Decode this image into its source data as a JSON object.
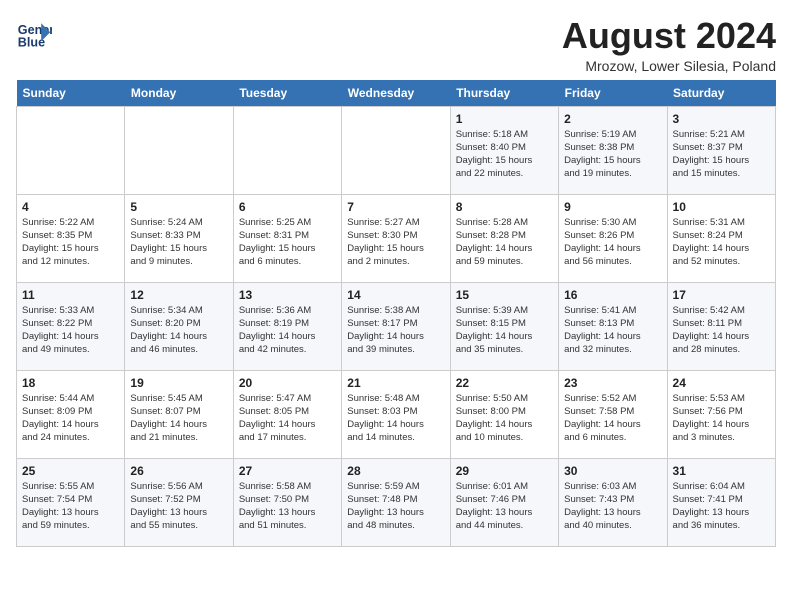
{
  "header": {
    "logo_line1": "General",
    "logo_line2": "Blue",
    "month_title": "August 2024",
    "location": "Mrozow, Lower Silesia, Poland"
  },
  "weekdays": [
    "Sunday",
    "Monday",
    "Tuesday",
    "Wednesday",
    "Thursday",
    "Friday",
    "Saturday"
  ],
  "weeks": [
    [
      {
        "day": "",
        "info": ""
      },
      {
        "day": "",
        "info": ""
      },
      {
        "day": "",
        "info": ""
      },
      {
        "day": "",
        "info": ""
      },
      {
        "day": "1",
        "info": "Sunrise: 5:18 AM\nSunset: 8:40 PM\nDaylight: 15 hours\nand 22 minutes."
      },
      {
        "day": "2",
        "info": "Sunrise: 5:19 AM\nSunset: 8:38 PM\nDaylight: 15 hours\nand 19 minutes."
      },
      {
        "day": "3",
        "info": "Sunrise: 5:21 AM\nSunset: 8:37 PM\nDaylight: 15 hours\nand 15 minutes."
      }
    ],
    [
      {
        "day": "4",
        "info": "Sunrise: 5:22 AM\nSunset: 8:35 PM\nDaylight: 15 hours\nand 12 minutes."
      },
      {
        "day": "5",
        "info": "Sunrise: 5:24 AM\nSunset: 8:33 PM\nDaylight: 15 hours\nand 9 minutes."
      },
      {
        "day": "6",
        "info": "Sunrise: 5:25 AM\nSunset: 8:31 PM\nDaylight: 15 hours\nand 6 minutes."
      },
      {
        "day": "7",
        "info": "Sunrise: 5:27 AM\nSunset: 8:30 PM\nDaylight: 15 hours\nand 2 minutes."
      },
      {
        "day": "8",
        "info": "Sunrise: 5:28 AM\nSunset: 8:28 PM\nDaylight: 14 hours\nand 59 minutes."
      },
      {
        "day": "9",
        "info": "Sunrise: 5:30 AM\nSunset: 8:26 PM\nDaylight: 14 hours\nand 56 minutes."
      },
      {
        "day": "10",
        "info": "Sunrise: 5:31 AM\nSunset: 8:24 PM\nDaylight: 14 hours\nand 52 minutes."
      }
    ],
    [
      {
        "day": "11",
        "info": "Sunrise: 5:33 AM\nSunset: 8:22 PM\nDaylight: 14 hours\nand 49 minutes."
      },
      {
        "day": "12",
        "info": "Sunrise: 5:34 AM\nSunset: 8:20 PM\nDaylight: 14 hours\nand 46 minutes."
      },
      {
        "day": "13",
        "info": "Sunrise: 5:36 AM\nSunset: 8:19 PM\nDaylight: 14 hours\nand 42 minutes."
      },
      {
        "day": "14",
        "info": "Sunrise: 5:38 AM\nSunset: 8:17 PM\nDaylight: 14 hours\nand 39 minutes."
      },
      {
        "day": "15",
        "info": "Sunrise: 5:39 AM\nSunset: 8:15 PM\nDaylight: 14 hours\nand 35 minutes."
      },
      {
        "day": "16",
        "info": "Sunrise: 5:41 AM\nSunset: 8:13 PM\nDaylight: 14 hours\nand 32 minutes."
      },
      {
        "day": "17",
        "info": "Sunrise: 5:42 AM\nSunset: 8:11 PM\nDaylight: 14 hours\nand 28 minutes."
      }
    ],
    [
      {
        "day": "18",
        "info": "Sunrise: 5:44 AM\nSunset: 8:09 PM\nDaylight: 14 hours\nand 24 minutes."
      },
      {
        "day": "19",
        "info": "Sunrise: 5:45 AM\nSunset: 8:07 PM\nDaylight: 14 hours\nand 21 minutes."
      },
      {
        "day": "20",
        "info": "Sunrise: 5:47 AM\nSunset: 8:05 PM\nDaylight: 14 hours\nand 17 minutes."
      },
      {
        "day": "21",
        "info": "Sunrise: 5:48 AM\nSunset: 8:03 PM\nDaylight: 14 hours\nand 14 minutes."
      },
      {
        "day": "22",
        "info": "Sunrise: 5:50 AM\nSunset: 8:00 PM\nDaylight: 14 hours\nand 10 minutes."
      },
      {
        "day": "23",
        "info": "Sunrise: 5:52 AM\nSunset: 7:58 PM\nDaylight: 14 hours\nand 6 minutes."
      },
      {
        "day": "24",
        "info": "Sunrise: 5:53 AM\nSunset: 7:56 PM\nDaylight: 14 hours\nand 3 minutes."
      }
    ],
    [
      {
        "day": "25",
        "info": "Sunrise: 5:55 AM\nSunset: 7:54 PM\nDaylight: 13 hours\nand 59 minutes."
      },
      {
        "day": "26",
        "info": "Sunrise: 5:56 AM\nSunset: 7:52 PM\nDaylight: 13 hours\nand 55 minutes."
      },
      {
        "day": "27",
        "info": "Sunrise: 5:58 AM\nSunset: 7:50 PM\nDaylight: 13 hours\nand 51 minutes."
      },
      {
        "day": "28",
        "info": "Sunrise: 5:59 AM\nSunset: 7:48 PM\nDaylight: 13 hours\nand 48 minutes."
      },
      {
        "day": "29",
        "info": "Sunrise: 6:01 AM\nSunset: 7:46 PM\nDaylight: 13 hours\nand 44 minutes."
      },
      {
        "day": "30",
        "info": "Sunrise: 6:03 AM\nSunset: 7:43 PM\nDaylight: 13 hours\nand 40 minutes."
      },
      {
        "day": "31",
        "info": "Sunrise: 6:04 AM\nSunset: 7:41 PM\nDaylight: 13 hours\nand 36 minutes."
      }
    ]
  ]
}
